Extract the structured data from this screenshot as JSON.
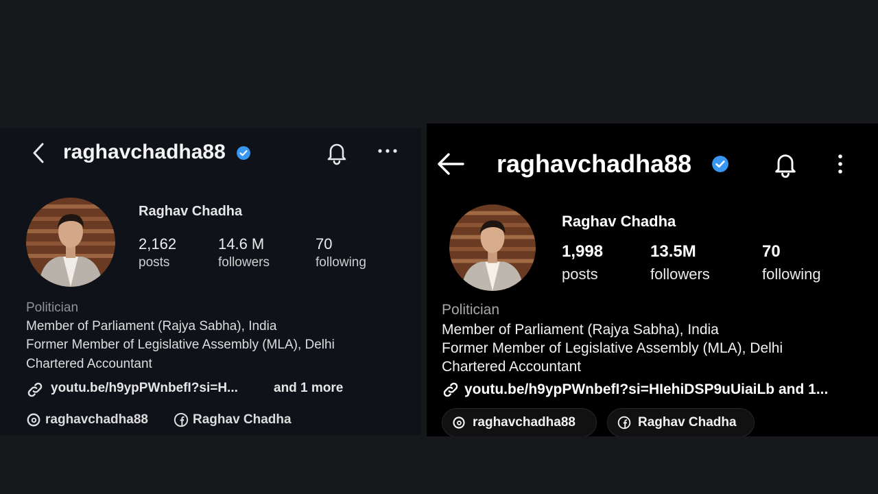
{
  "colors": {
    "background": "#17181c",
    "left_panel_bg": "#0f1219",
    "right_panel_bg": "#000000",
    "verified_blue": "#3897f0"
  },
  "left": {
    "header": {
      "back_icon": "chevron-left-icon",
      "username": "raghavchadha88",
      "verified_icon": "verified-badge-icon",
      "bell_icon": "bell-icon",
      "more_icon": "more-horizontal-icon"
    },
    "profile": {
      "full_name": "Raghav Chadha",
      "stats": [
        {
          "value": "2,162",
          "label": "posts"
        },
        {
          "value": "14.6 M",
          "label": "followers"
        },
        {
          "value": "70",
          "label": "following"
        }
      ]
    },
    "bio": {
      "category": "Politician",
      "lines": [
        "Member of Parliament (Rajya Sabha), India",
        "Former Member of Legislative Assembly (MLA), Delhi",
        "Chartered Accountant"
      ],
      "link_text": "youtu.be/h9ypPWnbefI?si=H...",
      "link_more": "and 1 more"
    },
    "chips": [
      {
        "icon": "threads-icon",
        "label": "raghavchadha88"
      },
      {
        "icon": "facebook-icon",
        "label": "Raghav Chadha"
      }
    ]
  },
  "right": {
    "header": {
      "back_icon": "arrow-left-icon",
      "username": "raghavchadha88",
      "verified_icon": "verified-badge-icon",
      "bell_icon": "bell-icon",
      "more_icon": "more-vertical-icon"
    },
    "profile": {
      "full_name": "Raghav Chadha",
      "stats": [
        {
          "value": "1,998",
          "label": "posts"
        },
        {
          "value": "13.5M",
          "label": "followers"
        },
        {
          "value": "70",
          "label": "following"
        }
      ]
    },
    "bio": {
      "category": "Politician",
      "lines": [
        "Member of Parliament (Rajya Sabha), India",
        "Former Member of Legislative Assembly (MLA), Delhi",
        "Chartered Accountant"
      ],
      "link_text": "youtu.be/h9ypPWnbefI?si=HIehiDSP9uUiaiLb and 1..."
    },
    "chips": [
      {
        "icon": "threads-icon",
        "label": "raghavchadha88"
      },
      {
        "icon": "facebook-icon",
        "label": "Raghav Chadha"
      }
    ]
  }
}
